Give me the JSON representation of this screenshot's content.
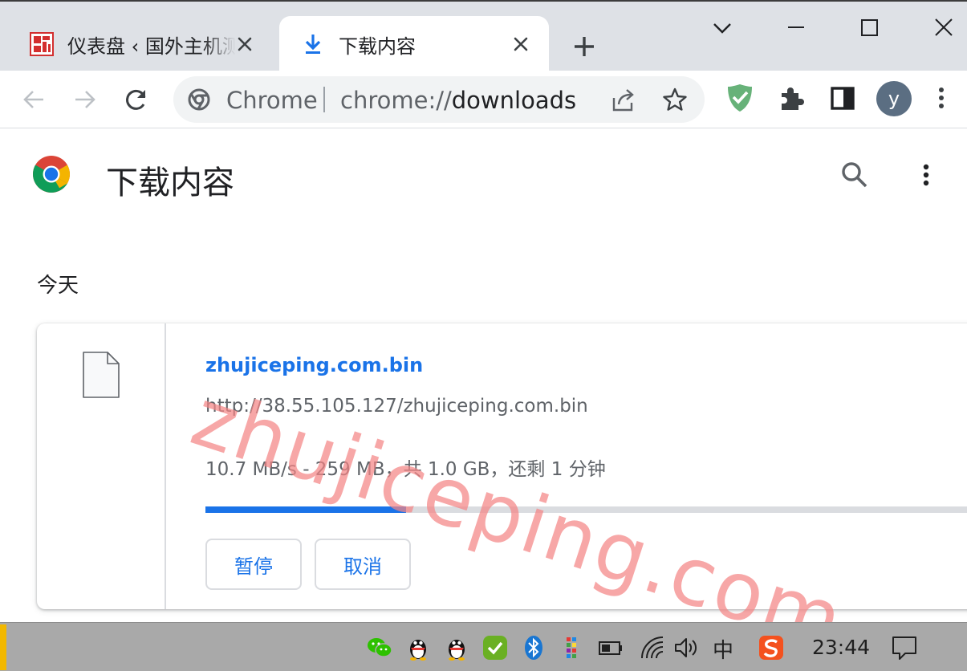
{
  "tabs": [
    {
      "title": "仪表盘 ‹ 国外主机测评 — WordPress",
      "active": false,
      "favicon": "red-site-favicon"
    },
    {
      "title": "下载内容",
      "active": true,
      "favicon": "download-arrow-icon"
    }
  ],
  "window_controls": {
    "tab_search": "chevron-down-icon",
    "minimize": "minimize-icon",
    "maximize": "maximize-icon",
    "close": "close-icon"
  },
  "omnibox": {
    "label": "Chrome",
    "url_scheme": "chrome://",
    "url_host": "downloads"
  },
  "profile": {
    "initial": "y"
  },
  "page": {
    "title": "下载内容",
    "date_heading": "今天",
    "download": {
      "file_name": "zhujiceping.com.bin",
      "url": "http://38.55.105.127/zhujiceping.com.bin",
      "status": "10.7 MB/s - 259 MB，共 1.0 GB，还剩 1 分钟",
      "progress_fraction": 0.26,
      "pause_label": "暂停",
      "cancel_label": "取消"
    },
    "watermark": "zhujiceping.com"
  },
  "taskbar": {
    "ime": "中",
    "clock": "23:44",
    "tray_icons": [
      "wechat-icon",
      "qq-icon",
      "qq-icon",
      "security-check-icon",
      "bluetooth-icon",
      "colorful-app-icon",
      "battery-icon",
      "wifi-icon",
      "volume-icon",
      "sogou-ime-icon",
      "notification-icon"
    ]
  },
  "colors": {
    "accent": "#1a73e8",
    "tabstrip": "#dee1e6",
    "taskbar": "#a9a9a9",
    "watermark": "#f48585"
  }
}
